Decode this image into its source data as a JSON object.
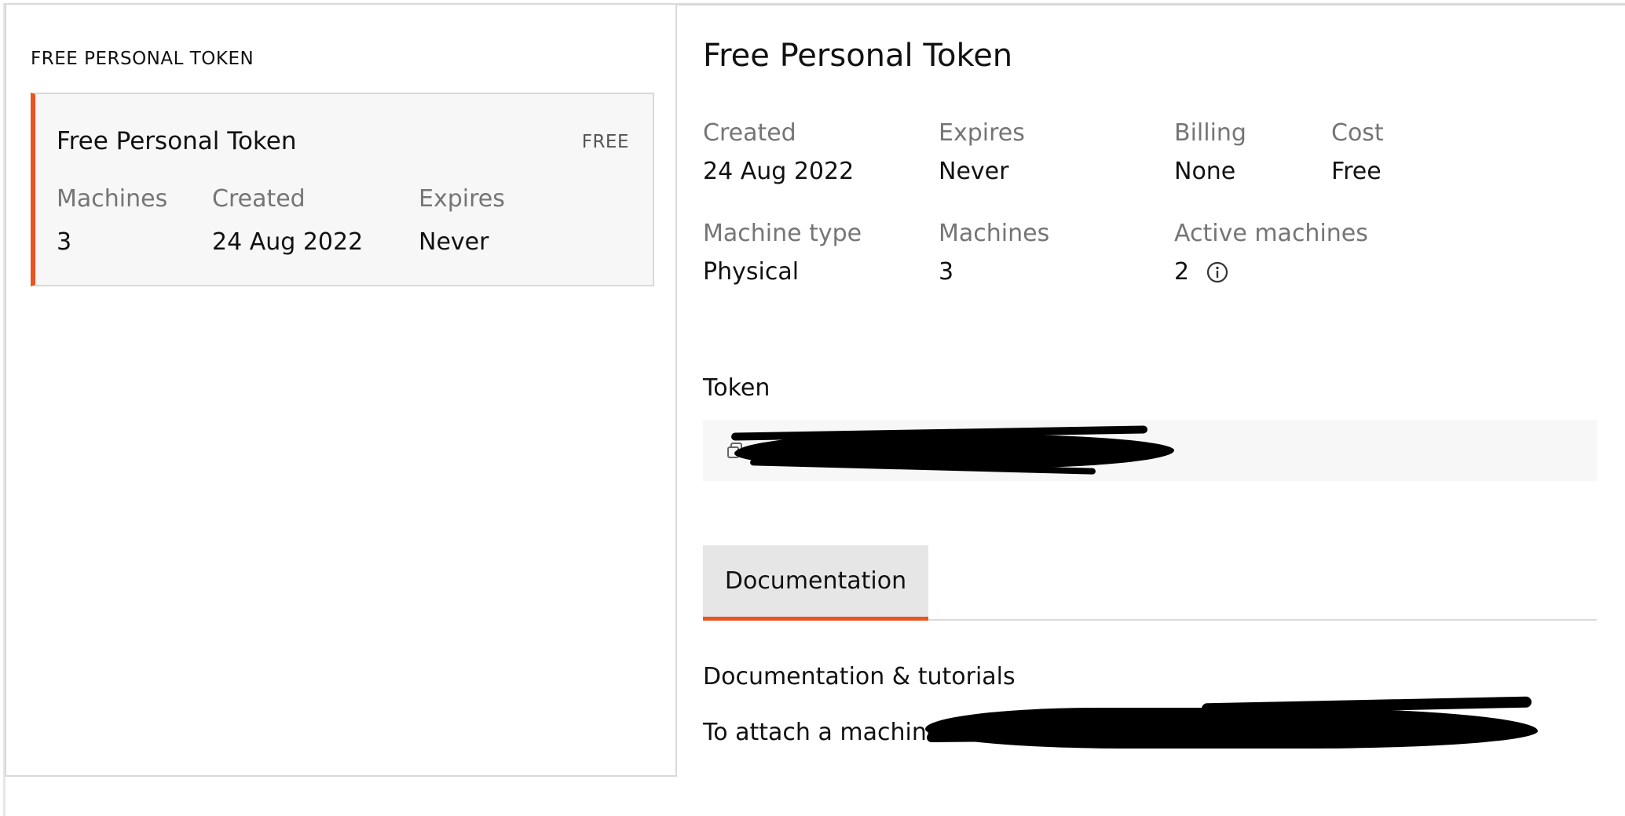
{
  "left": {
    "heading": "FREE PERSONAL TOKEN",
    "card": {
      "title": "Free Personal Token",
      "badge": "FREE",
      "machines_label": "Machines",
      "machines_value": "3",
      "created_label": "Created",
      "created_value": "24 Aug 2022",
      "expires_label": "Expires",
      "expires_value": "Never"
    }
  },
  "detail": {
    "title": "Free Personal Token",
    "created_label": "Created",
    "created_value": "24 Aug 2022",
    "expires_label": "Expires",
    "expires_value": "Never",
    "billing_label": "Billing",
    "billing_value": "None",
    "cost_label": "Cost",
    "cost_value": "Free",
    "machine_type_label": "Machine type",
    "machine_type_value": "Physical",
    "machines_label": "Machines",
    "machines_value": "3",
    "active_machines_label": "Active machines",
    "active_machines_value": "2"
  },
  "token": {
    "heading": "Token"
  },
  "tabs": [
    {
      "label": "Documentation",
      "active": true
    }
  ],
  "docs": {
    "heading": "Documentation & tutorials",
    "text": "To attach a machine"
  },
  "colors": {
    "accent": "#e95420",
    "muted_text": "#757575",
    "card_bg": "#f7f7f7",
    "border": "#d9d9d9"
  },
  "icons": {
    "info": "info-icon",
    "copy": "copy-icon"
  }
}
